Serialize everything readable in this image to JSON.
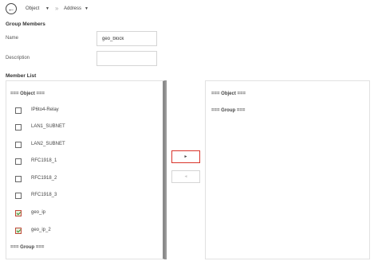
{
  "breadcrumb": {
    "back_icon": "←",
    "items": [
      "Object",
      "Address"
    ],
    "caret": "▼",
    "separator": "»"
  },
  "group_members": {
    "title": "Group Members",
    "name_label": "Name",
    "name_value": "geo_block",
    "description_label": "Description",
    "description_value": ""
  },
  "member_list": {
    "title": "Member List",
    "available": {
      "object_header": "=== Object ===",
      "items": [
        {
          "label": "IP6to4-Relay",
          "checked": false
        },
        {
          "label": "LAN1_SUBNET",
          "checked": false
        },
        {
          "label": "LAN2_SUBNET",
          "checked": false
        },
        {
          "label": "RFC1918_1",
          "checked": false
        },
        {
          "label": "RFC1918_2",
          "checked": false
        },
        {
          "label": "RFC1918_3",
          "checked": false
        },
        {
          "label": "geo_ip",
          "checked": true
        },
        {
          "label": "geo_ip_2",
          "checked": true
        }
      ],
      "group_header": "=== Group ==="
    },
    "selected": {
      "object_header": "=== Object ===",
      "group_header": "=== Group ==="
    },
    "move_right_label": "►",
    "move_left_label": "◄"
  },
  "colors": {
    "accent_red": "#d9342b",
    "check_green": "#3a8a2a"
  }
}
